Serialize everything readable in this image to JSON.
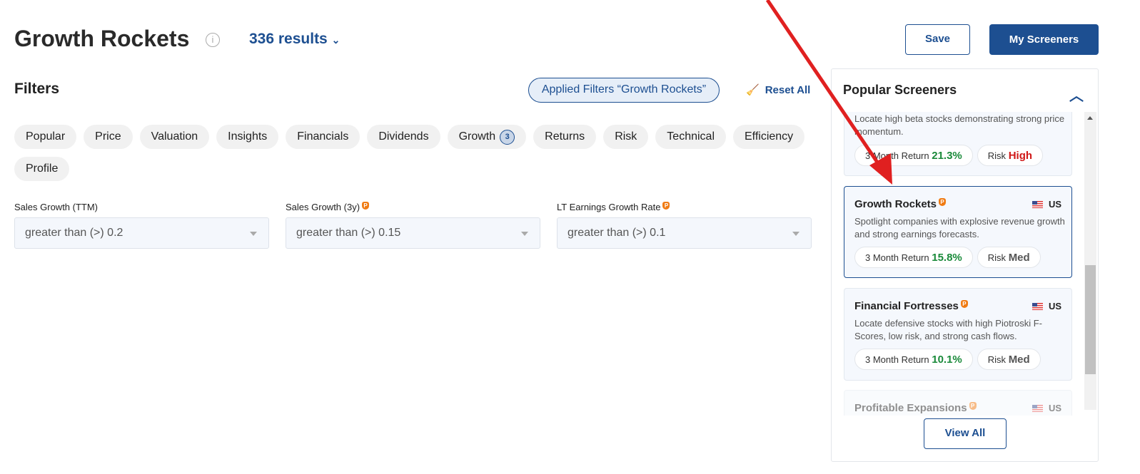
{
  "header": {
    "title": "Growth Rockets",
    "results": "336 results",
    "save_label": "Save",
    "my_screeners_label": "My Screeners"
  },
  "filters": {
    "heading": "Filters",
    "applied_label": "Applied Filters “Growth Rockets”",
    "reset_label": "Reset All",
    "tabs": [
      {
        "label": "Popular"
      },
      {
        "label": "Price"
      },
      {
        "label": "Valuation"
      },
      {
        "label": "Insights"
      },
      {
        "label": "Financials"
      },
      {
        "label": "Dividends"
      },
      {
        "label": "Growth",
        "badge": "3"
      },
      {
        "label": "Returns"
      },
      {
        "label": "Risk"
      },
      {
        "label": "Technical"
      },
      {
        "label": "Efficiency"
      },
      {
        "label": "Profile"
      }
    ],
    "fields": [
      {
        "label": "Sales Growth (TTM)",
        "value": "greater than (>) 0.2",
        "premium": false
      },
      {
        "label": "Sales Growth (3y)",
        "value": "greater than (>) 0.15",
        "premium": true
      },
      {
        "label": "LT Earnings Growth Rate",
        "value": "greater than (>) 0.1",
        "premium": true
      }
    ]
  },
  "popular": {
    "heading": "Popular Screeners",
    "view_all": "View All",
    "cards": [
      {
        "title": "",
        "desc": "Locate high beta stocks demonstrating strong price momentum.",
        "return_label": "3 Month Return",
        "return": "21.3%",
        "risk_label": "Risk",
        "risk": "High"
      },
      {
        "title": "Growth Rockets",
        "country": "US",
        "desc": "Spotlight companies with explosive revenue growth and strong earnings forecasts.",
        "return_label": "3 Month Return",
        "return": "15.8%",
        "risk_label": "Risk",
        "risk": "Med"
      },
      {
        "title": "Financial Fortresses",
        "country": "US",
        "desc": "Locate defensive stocks with high Piotroski F-Scores, low risk, and strong cash flows.",
        "return_label": "3 Month Return",
        "return": "10.1%",
        "risk_label": "Risk",
        "risk": "Med"
      },
      {
        "title": "Profitable Expansions",
        "country": "US"
      }
    ]
  },
  "colors": {
    "brand": "#1d4f91",
    "positive": "#1a8a3a",
    "high_risk": "#d01818",
    "annotation_arrow": "#e02020"
  }
}
